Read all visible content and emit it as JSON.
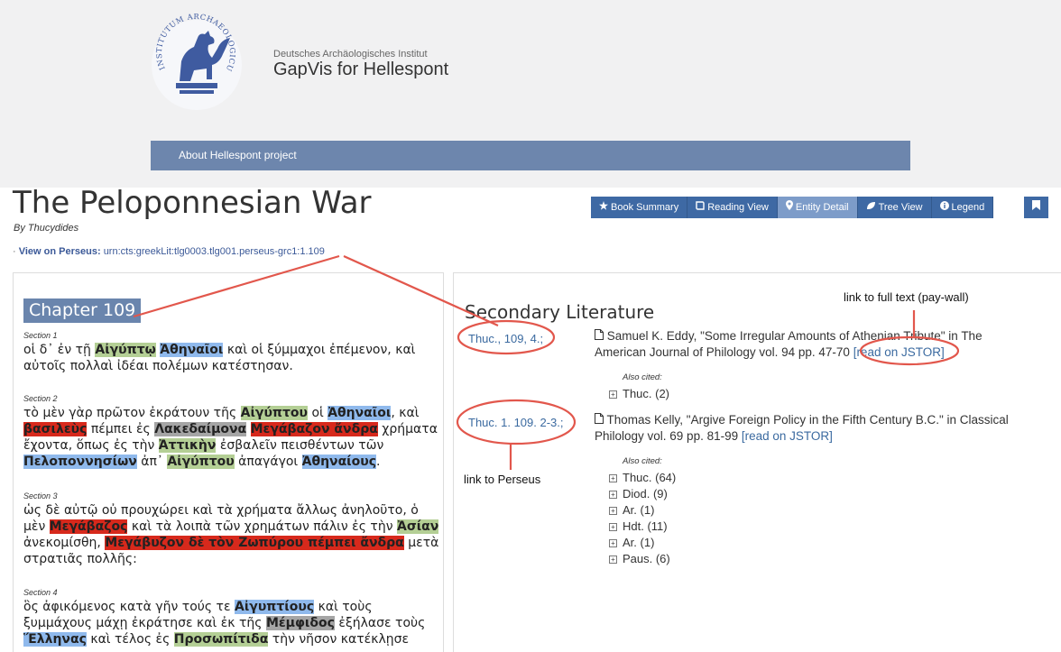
{
  "header": {
    "institute": "Deutsches Archäologisches Institut",
    "app_name": "GapVis for Hellespont",
    "logo_text": "INSTITUTUM ARCHAEOLOGICUM GERMANICUM",
    "nav_link": "About Hellespont project"
  },
  "page": {
    "title": "The Peloponnesian War",
    "author": "By Thucydides",
    "perseus_prefix": "·",
    "perseus_label": "View on Perseus:",
    "perseus_urn": "urn:cts:greekLit:tlg0003.tlg001.perseus-grc1:1.109"
  },
  "toolbar": {
    "buttons": [
      {
        "icon": "star-icon",
        "label": "Book Summary"
      },
      {
        "icon": "book-icon",
        "label": "Reading View"
      },
      {
        "icon": "map-marker-icon",
        "label": "Entity Detail",
        "active": true
      },
      {
        "icon": "leaf-icon",
        "label": "Tree View"
      },
      {
        "icon": "info-icon",
        "label": "Legend"
      }
    ],
    "bookmark_icon": "bookmark-icon"
  },
  "reading": {
    "chapter": "Chapter 109",
    "sections": [
      {
        "label": "Section 1",
        "lines": [
          [
            [
              "οἱ δ᾽ ἐν τῇ ",
              ""
            ],
            [
              "Αἰγύπτῳ",
              "g"
            ],
            [
              " ",
              ""
            ],
            [
              "Ἀθηναῖοι",
              "b"
            ],
            [
              " καὶ οἱ ξύμμαχοι ἐπέμενον, καὶ",
              ""
            ]
          ],
          [
            [
              "αὐτοῖς πολλαὶ ἰδέαι πολέμων κατέστησαν.",
              ""
            ]
          ]
        ]
      },
      {
        "label": "Section 2",
        "lines": [
          [
            [
              "τὸ μὲν γὰρ πρῶτον ἐκράτουν τῆς ",
              ""
            ],
            [
              "Αἰγύπτου",
              "g"
            ],
            [
              " οἱ ",
              ""
            ],
            [
              "Ἀθηναῖοι",
              "b"
            ],
            [
              ", καὶ",
              ""
            ]
          ],
          [
            [
              "βασιλεὺς",
              "r"
            ],
            [
              " πέμπει ἐς ",
              ""
            ],
            [
              "Λακεδαίμονα",
              "gr"
            ],
            [
              " ",
              ""
            ],
            [
              "Μεγάβαζον ἄνδρα",
              "r"
            ],
            [
              " χρήματα",
              ""
            ]
          ],
          [
            [
              "ἔχοντα, ὅπως ἐς τὴν ",
              ""
            ],
            [
              "Ἀττικὴν",
              "g"
            ],
            [
              " ἐσβαλεῖν πεισθέντων τῶν",
              ""
            ]
          ],
          [
            [
              "Πελοποννησίων",
              "b"
            ],
            [
              " ἀπ᾽ ",
              ""
            ],
            [
              "Αἰγύπτου",
              "g"
            ],
            [
              " ἀπαγάγοι ",
              ""
            ],
            [
              "Ἀθηναίους",
              "b"
            ],
            [
              ".",
              ""
            ]
          ]
        ]
      },
      {
        "label": "Section 3",
        "lines": [
          [
            [
              "ὡς δὲ αὐτῷ οὐ προυχώρει καὶ τὰ χρήματα ἄλλως ἀνηλοῦτο, ὁ",
              ""
            ]
          ],
          [
            [
              "μὲν ",
              ""
            ],
            [
              "Μεγάβαζος",
              "r"
            ],
            [
              " καὶ τὰ λοιπὰ τῶν χρημάτων πάλιν ἐς τὴν ",
              ""
            ],
            [
              "Ἀσίαν",
              "g"
            ]
          ],
          [
            [
              "ἀνεκομίσθη, ",
              ""
            ],
            [
              "Μεγάβυζον δὲ τὸν Ζωπύρου πέμπει ἄνδρα",
              "r"
            ],
            [
              " μετὰ",
              ""
            ]
          ],
          [
            [
              "στρατιᾶς πολλῆς:",
              ""
            ]
          ]
        ]
      },
      {
        "label": "Section 4",
        "lines": [
          [
            [
              "ὃς ἀφικόμενος κατὰ γῆν τούς τε ",
              ""
            ],
            [
              "Αἰγυπτίους",
              "b"
            ],
            [
              " καὶ τοὺς",
              ""
            ]
          ],
          [
            [
              "ξυμμάχους μάχῃ ἐκράτησε καὶ ἐκ τῆς ",
              ""
            ],
            [
              "Μέμφιδος",
              "gr"
            ],
            [
              " ἐξήλασε τοὺς",
              ""
            ]
          ],
          [
            [
              "Ἕλληνας",
              "b"
            ],
            [
              " καὶ τέλος ἐς ",
              ""
            ],
            [
              "Προσωπίτιδα",
              "g"
            ],
            [
              " τὴν νῆσον κατέκλῃσε",
              ""
            ]
          ]
        ]
      }
    ]
  },
  "secondary": {
    "heading": "Secondary Literature",
    "entries": [
      {
        "citation": "Thuc., 109, 4.;",
        "text": "Samuel K. Eddy, \"Some Irregular Amounts of Athenian Tribute\" in The American Journal of Philology vol. 94 pp. 47-70",
        "link": "[read on JSTOR]",
        "also_label": "Also cited:",
        "also": [
          {
            "label": "Thuc. (2)"
          }
        ]
      },
      {
        "citation": "Thuc. 1. 109. 2-3.;",
        "text": "Thomas Kelly, \"Argive Foreign Policy in the Fifth Century B.C.\" in Classical Philology vol. 69 pp. 81-99",
        "link": "[read on JSTOR]",
        "also_label": "Also cited:",
        "also": [
          {
            "label": "Thuc. (64)"
          },
          {
            "label": "Diod. (9)"
          },
          {
            "label": "Ar. (1)"
          },
          {
            "label": "Hdt. (11)"
          },
          {
            "label": "Ar. (1)"
          },
          {
            "label": "Paus. (6)"
          }
        ]
      }
    ]
  },
  "annotations": {
    "full_text": "link to full text (pay-wall)",
    "perseus": "link to Perseus"
  },
  "colors": {
    "nav": "#6d86ad",
    "button": "#3e69a4",
    "button_active": "#7d9cc9",
    "place": "#b4cf95",
    "group": "#8fb9ec",
    "person": "#d7291c",
    "other": "#a5a5a5",
    "annotation": "#e2574c"
  }
}
